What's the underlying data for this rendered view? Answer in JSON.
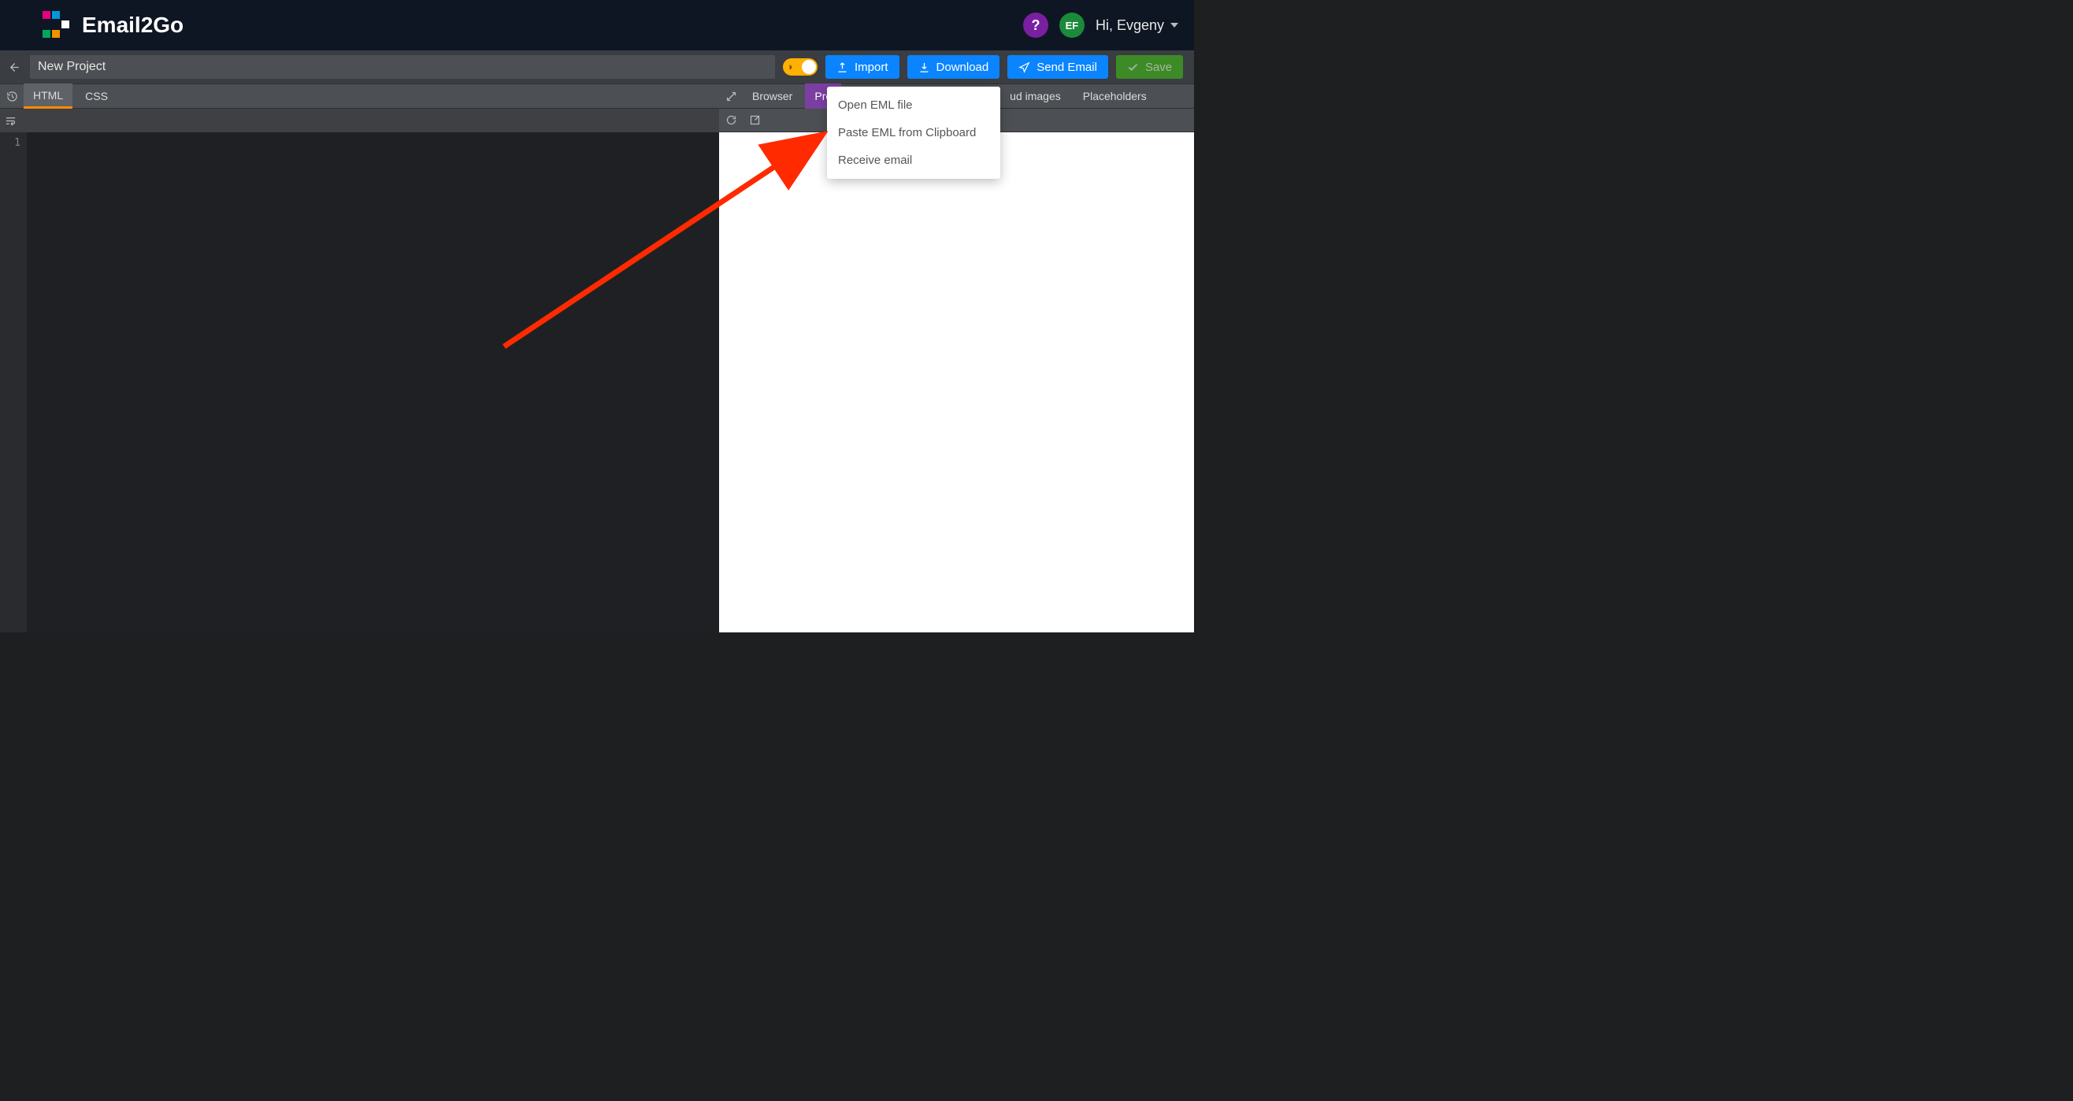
{
  "header": {
    "app_name": "Email2Go",
    "help_symbol": "?",
    "user_initials": "EF",
    "greeting": "Hi, Evgeny"
  },
  "toolbar": {
    "project_title": "New Project",
    "import_label": "Import",
    "download_label": "Download",
    "send_label": "Send Email",
    "save_label": "Save"
  },
  "editor_tabs": {
    "html": "HTML",
    "css": "CSS"
  },
  "preview_tabs": {
    "browser": "Browser",
    "preview_prefix": "Pre",
    "cloud_images_suffix": "ud images",
    "placeholders": "Placeholders"
  },
  "import_menu": {
    "open_eml": "Open EML file",
    "paste_eml": "Paste EML from Clipboard",
    "receive_email": "Receive email"
  },
  "editor": {
    "first_line_number": "1"
  }
}
